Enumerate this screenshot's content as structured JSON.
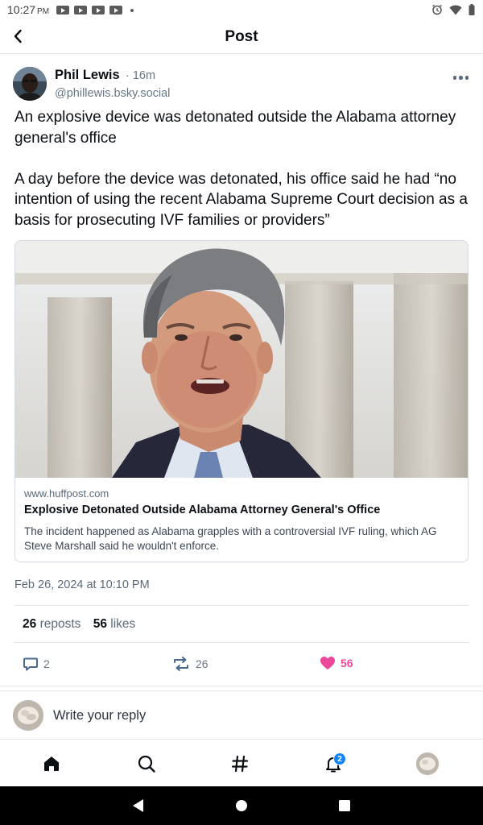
{
  "status_bar": {
    "time": "10:27",
    "ampm": "PM"
  },
  "header": {
    "title": "Post"
  },
  "post": {
    "author_name": "Phil Lewis",
    "time": "· 16m",
    "handle": "@phillewis.bsky.social",
    "text": "An explosive device was detonated outside the Alabama attorney general's office\n\nA day before the device was detonated, his office said he had “no intention of using the recent Alabama Supreme Court decision as a basis for prosecuting IVF families or providers”",
    "link_card": {
      "domain": "www.huffpost.com",
      "title": "Explosive Detonated Outside Alabama Attorney General's Office",
      "description": "The incident happened as Alabama grapples with a controversial IVF ruling, which AG Steve Marshall said he wouldn't enforce."
    },
    "date": "Feb 26, 2024 at 10:10 PM",
    "stats": {
      "reposts_count": "26",
      "reposts_label": "reposts",
      "likes_count": "56",
      "likes_label": "likes"
    },
    "actions": {
      "replies": "2",
      "reposts": "26",
      "likes": "56"
    }
  },
  "reply": {
    "placeholder": "Write your reply"
  },
  "tabbar": {
    "notifications_badge": "2"
  },
  "colors": {
    "like": "#ec4899",
    "badge": "#1083fe",
    "muted": "#687684"
  }
}
